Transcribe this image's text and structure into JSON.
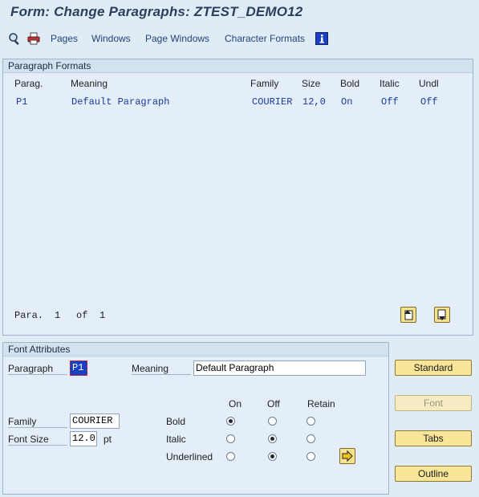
{
  "window": {
    "title": "Form: Change Paragraphs: ZTEST_DEMO12"
  },
  "toolbar": {
    "icons": [
      "display-object-icon",
      "print-icon"
    ],
    "links": [
      "Pages",
      "Windows",
      "Page Windows",
      "Character Formats"
    ],
    "info_icon": "info-icon"
  },
  "paragraph_formats": {
    "title": "Paragraph Formats",
    "columns": [
      "Parag.",
      "Meaning",
      "Family",
      "Size",
      "Bold",
      "Italic",
      "Undl"
    ],
    "rows": [
      {
        "parag": "P1",
        "meaning": "Default Paragraph",
        "family": "COURIER",
        "size": "12,0",
        "bold": "On",
        "italic": "Off",
        "undl": "Off"
      }
    ],
    "pager": {
      "label": "Para.",
      "current": "1",
      "of": "of",
      "total": "1"
    }
  },
  "font_attributes": {
    "title": "Font Attributes",
    "paragraph_label": "Paragraph",
    "paragraph_value": "P1",
    "meaning_label": "Meaning",
    "meaning_value": "Default Paragraph",
    "columns": [
      "On",
      "Off",
      "Retain"
    ],
    "family_label": "Family",
    "family_value": "COURIER",
    "font_size_label": "Font Size",
    "font_size_value": "12.0",
    "font_size_unit": "pt",
    "attributes": [
      {
        "label": "Bold",
        "selected": "On"
      },
      {
        "label": "Italic",
        "selected": "Off"
      },
      {
        "label": "Underlined",
        "selected": "Off"
      }
    ]
  },
  "side_buttons": {
    "standard": "Standard",
    "font": "Font",
    "tabs": "Tabs",
    "outline": "Outline"
  }
}
